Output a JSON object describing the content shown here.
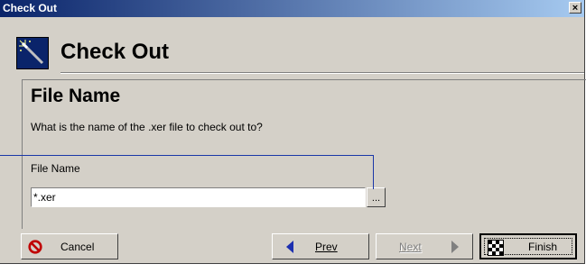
{
  "window": {
    "title": "Check Out",
    "close_glyph": "×"
  },
  "header": {
    "title": "Check Out",
    "icon": "magic-wand-icon"
  },
  "section": {
    "title": "File Name",
    "description": "What is the name of the .xer file to check out to?"
  },
  "form": {
    "field_label": "File Name",
    "field_value": "*.xer",
    "browse_label": "..."
  },
  "buttons": {
    "cancel": "Cancel",
    "prev": "Prev",
    "next": "Next",
    "finish": "Finish"
  },
  "colors": {
    "titlebar": "#0a246a",
    "dialog_bg": "#d4d0c8",
    "callout_line": "#1a37a8",
    "cancel_icon": "#c00000",
    "nav_arrow_active": "#1c2fb0",
    "nav_arrow_disabled": "#808080"
  }
}
